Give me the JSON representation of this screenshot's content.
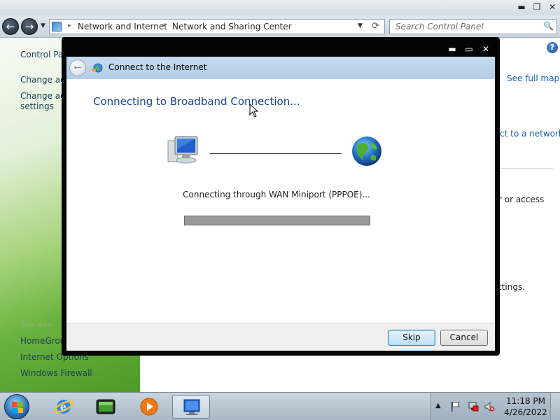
{
  "explorer": {
    "address": {
      "crumbs": [
        "Network and Internet",
        "Network and Sharing Center"
      ]
    },
    "search_placeholder": "Search Control Panel",
    "sidebar": {
      "control_panel_home": "Control Pa",
      "change_adapter": "Change ad",
      "change_advanced_line1": "Change ad",
      "change_advanced_line2": "settings",
      "see_also": "See also",
      "see_also_links": [
        "HomeGroup",
        "Internet Options",
        "Windows Firewall"
      ]
    },
    "main": {
      "see_full_map": "See full map",
      "connect_to_network": "ct to a network",
      "or_access": "r or access",
      "settings": "ttings."
    }
  },
  "dialog": {
    "title": "Connect to the Internet",
    "heading": "Connecting to Broadband Connection...",
    "status": "Connecting through WAN Miniport (PPPOE)...",
    "progress_fraction": 0.0,
    "buttons": {
      "skip": "Skip",
      "cancel": "Cancel"
    }
  },
  "taskbar": {
    "pinned": [
      "internet-explorer",
      "media-center",
      "media-player",
      "network-connection"
    ],
    "clock": {
      "time": "11:18 PM",
      "date": "4/26/2022"
    }
  },
  "colors": {
    "heading_blue": "#1e3f8a",
    "link_blue": "#1c5ca6",
    "sidebar_green": "#69b23d"
  }
}
